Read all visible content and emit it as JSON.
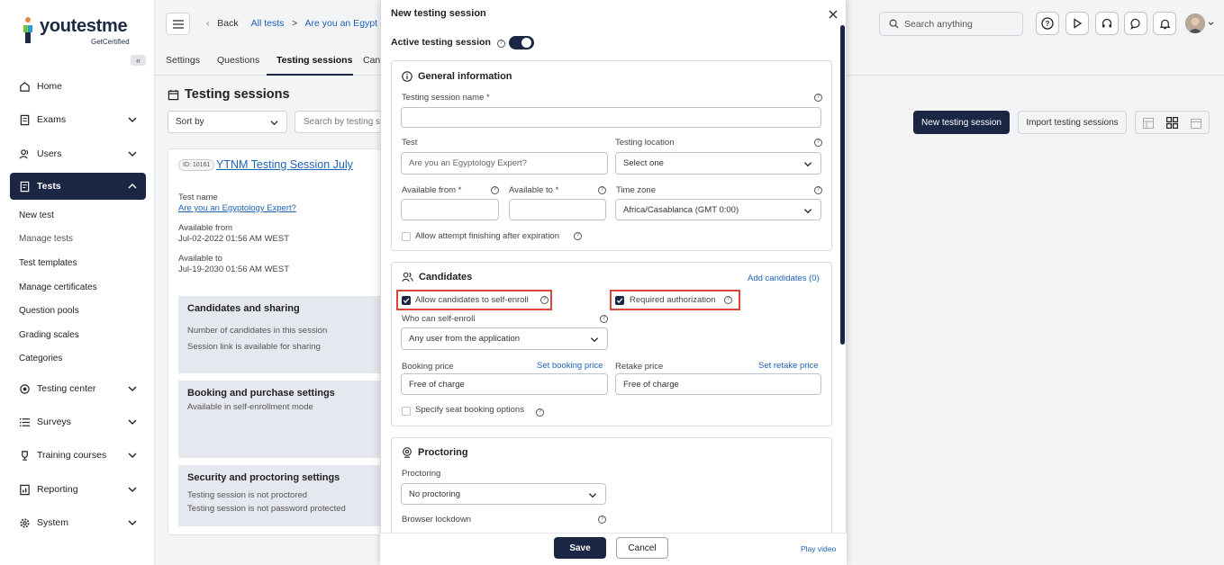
{
  "brand": {
    "logo_text": "youtestme",
    "logo_sub": "GetCertified"
  },
  "sidebar": {
    "collapse_label": "«",
    "items": [
      {
        "label": "Home",
        "icon": "home-icon"
      },
      {
        "label": "Exams",
        "icon": "exam-icon"
      },
      {
        "label": "Users",
        "icon": "users-icon"
      },
      {
        "label": "Tests",
        "icon": "tests-icon"
      },
      {
        "label": "Testing center",
        "icon": "testing-center-icon"
      },
      {
        "label": "Surveys",
        "icon": "surveys-icon"
      },
      {
        "label": "Training courses",
        "icon": "trophy-icon"
      },
      {
        "label": "Reporting",
        "icon": "reporting-icon"
      },
      {
        "label": "System",
        "icon": "gear-icon"
      }
    ],
    "sub_items": [
      "New test",
      "Manage tests",
      "Test templates",
      "Manage certificates",
      "Question pools",
      "Grading scales",
      "Categories"
    ]
  },
  "header": {
    "back": "Back",
    "crumb1": "All tests",
    "sep": ">",
    "crumb2": "Are you an Egypt",
    "search_placeholder": "Search anything"
  },
  "tabs": [
    "Settings",
    "Questions",
    "Testing sessions",
    "Can"
  ],
  "main": {
    "title": "Testing sessions",
    "sort_by": "Sort by",
    "search_placeholder": "Search by testing se",
    "new_session_btn": "New testing session",
    "import_btn": "Import testing sessions",
    "card": {
      "id_badge": "ID: 10161",
      "session_name": "YTNM Testing Session July",
      "test_name_label": "Test name",
      "test_name": "Are you an Egyptology Expert?",
      "available_from_label": "Available from",
      "available_from": "Jul-02-2022 01:56 AM WEST",
      "available_to_label": "Available to",
      "available_to": "Jul-19-2030 01:56 AM WEST",
      "box1_title": "Candidates and sharing",
      "box1_line1": "Number of candidates in this session",
      "box1_line2": "Session link is available for sharing",
      "box2_title": "Booking and purchase settings",
      "box2_line1": "Available in self-enrollment mode",
      "box3_title": "Security and proctoring settings",
      "box3_line1": "Testing session is not proctored",
      "box3_line2": "Testing session is not password protected"
    }
  },
  "modal": {
    "title": "New testing session",
    "active_label": "Active testing session",
    "general": {
      "title": "General information",
      "session_name_label": "Testing session name *",
      "test_label": "Test",
      "test_placeholder": "Are you an Egyptology Expert?",
      "location_label": "Testing location",
      "location_value": "Select one",
      "from_label": "Available from *",
      "to_label": "Available to *",
      "tz_label": "Time zone",
      "tz_value": "Africa/Casablanca (GMT 0:00)",
      "allow_finish_label": "Allow attempt finishing after expiration"
    },
    "candidates": {
      "title": "Candidates",
      "add_link": "Add candidates (0)",
      "self_enroll_label": "Allow candidates to self-enroll",
      "required_auth_label": "Required authorization",
      "who_label": "Who can self-enroll",
      "who_value": "Any user from the application",
      "booking_label": "Booking price",
      "booking_link": "Set booking price",
      "booking_value": "Free of charge",
      "retake_label": "Retake price",
      "retake_link": "Set retake price",
      "retake_value": "Free of charge",
      "seat_label": "Specify seat booking options"
    },
    "proctoring": {
      "title": "Proctoring",
      "proctoring_label": "Proctoring",
      "proctoring_value": "No proctoring",
      "lockdown_label": "Browser lockdown"
    },
    "save": "Save",
    "cancel": "Cancel",
    "play_video": "Play video"
  },
  "colors": {
    "navy": "#1b2544",
    "link": "#1c62b7",
    "highlight": "#d9463b"
  }
}
